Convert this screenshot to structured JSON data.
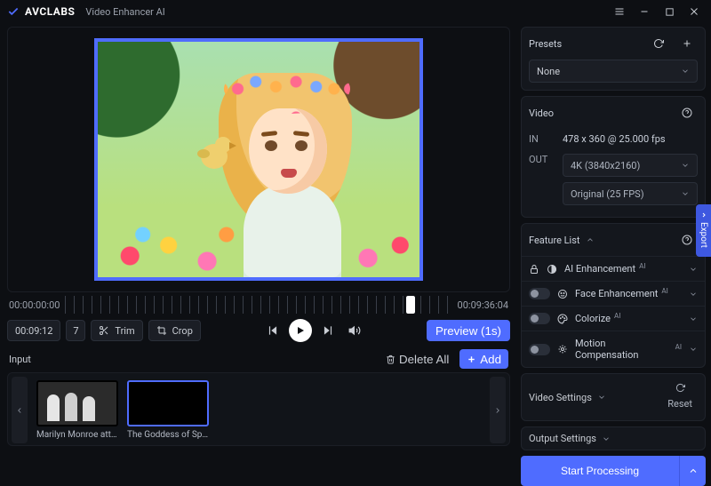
{
  "window": {
    "brand": "AVCLABS",
    "subtitle": "Video Enhancer AI"
  },
  "timeline": {
    "start": "00:00:00:00",
    "end": "00:09:36:04",
    "current": "00:09:12",
    "rate": "7"
  },
  "controls": {
    "trim": "Trim",
    "crop": "Crop",
    "preview": "Preview (1s)"
  },
  "input": {
    "title": "Input",
    "delete_all": "Delete All",
    "add": "Add",
    "clips": [
      {
        "caption": "Marilyn Monroe atten...",
        "selected": false
      },
      {
        "caption": "The Goddess of Sprin...",
        "selected": true
      }
    ]
  },
  "presets": {
    "title": "Presets",
    "value": "None"
  },
  "video": {
    "title": "Video",
    "in_label": "IN",
    "in_value": "478 x 360 @ 25.000 fps",
    "out_label": "OUT",
    "resolution": "4K (3840x2160)",
    "fps": "Original (25 FPS)"
  },
  "features": {
    "title": "Feature List",
    "items": [
      {
        "name": "AI Enhancement",
        "icon": "contrast",
        "locked": true,
        "sup": "AI"
      },
      {
        "name": "Face Enhancement",
        "icon": "face",
        "locked": false,
        "sup": "AI"
      },
      {
        "name": "Colorize",
        "icon": "palette",
        "locked": false,
        "sup": "AI"
      },
      {
        "name": "Motion Compensation",
        "icon": "motion",
        "locked": false,
        "sup": "AI"
      }
    ]
  },
  "sections": {
    "video_settings": "Video Settings",
    "reset": "Reset",
    "output_settings": "Output Settings"
  },
  "actions": {
    "start": "Start Processing",
    "export": "Export"
  }
}
